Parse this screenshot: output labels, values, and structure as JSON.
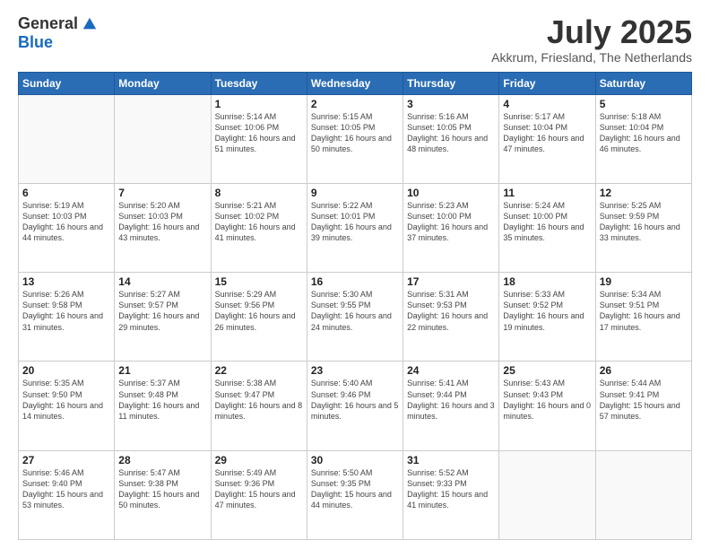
{
  "logo": {
    "general": "General",
    "blue": "Blue"
  },
  "title": "July 2025",
  "location": "Akkrum, Friesland, The Netherlands",
  "headers": [
    "Sunday",
    "Monday",
    "Tuesday",
    "Wednesday",
    "Thursday",
    "Friday",
    "Saturday"
  ],
  "weeks": [
    [
      {
        "day": "",
        "text": ""
      },
      {
        "day": "",
        "text": ""
      },
      {
        "day": "1",
        "text": "Sunrise: 5:14 AM\nSunset: 10:06 PM\nDaylight: 16 hours\nand 51 minutes."
      },
      {
        "day": "2",
        "text": "Sunrise: 5:15 AM\nSunset: 10:05 PM\nDaylight: 16 hours\nand 50 minutes."
      },
      {
        "day": "3",
        "text": "Sunrise: 5:16 AM\nSunset: 10:05 PM\nDaylight: 16 hours\nand 48 minutes."
      },
      {
        "day": "4",
        "text": "Sunrise: 5:17 AM\nSunset: 10:04 PM\nDaylight: 16 hours\nand 47 minutes."
      },
      {
        "day": "5",
        "text": "Sunrise: 5:18 AM\nSunset: 10:04 PM\nDaylight: 16 hours\nand 46 minutes."
      }
    ],
    [
      {
        "day": "6",
        "text": "Sunrise: 5:19 AM\nSunset: 10:03 PM\nDaylight: 16 hours\nand 44 minutes."
      },
      {
        "day": "7",
        "text": "Sunrise: 5:20 AM\nSunset: 10:03 PM\nDaylight: 16 hours\nand 43 minutes."
      },
      {
        "day": "8",
        "text": "Sunrise: 5:21 AM\nSunset: 10:02 PM\nDaylight: 16 hours\nand 41 minutes."
      },
      {
        "day": "9",
        "text": "Sunrise: 5:22 AM\nSunset: 10:01 PM\nDaylight: 16 hours\nand 39 minutes."
      },
      {
        "day": "10",
        "text": "Sunrise: 5:23 AM\nSunset: 10:00 PM\nDaylight: 16 hours\nand 37 minutes."
      },
      {
        "day": "11",
        "text": "Sunrise: 5:24 AM\nSunset: 10:00 PM\nDaylight: 16 hours\nand 35 minutes."
      },
      {
        "day": "12",
        "text": "Sunrise: 5:25 AM\nSunset: 9:59 PM\nDaylight: 16 hours\nand 33 minutes."
      }
    ],
    [
      {
        "day": "13",
        "text": "Sunrise: 5:26 AM\nSunset: 9:58 PM\nDaylight: 16 hours\nand 31 minutes."
      },
      {
        "day": "14",
        "text": "Sunrise: 5:27 AM\nSunset: 9:57 PM\nDaylight: 16 hours\nand 29 minutes."
      },
      {
        "day": "15",
        "text": "Sunrise: 5:29 AM\nSunset: 9:56 PM\nDaylight: 16 hours\nand 26 minutes."
      },
      {
        "day": "16",
        "text": "Sunrise: 5:30 AM\nSunset: 9:55 PM\nDaylight: 16 hours\nand 24 minutes."
      },
      {
        "day": "17",
        "text": "Sunrise: 5:31 AM\nSunset: 9:53 PM\nDaylight: 16 hours\nand 22 minutes."
      },
      {
        "day": "18",
        "text": "Sunrise: 5:33 AM\nSunset: 9:52 PM\nDaylight: 16 hours\nand 19 minutes."
      },
      {
        "day": "19",
        "text": "Sunrise: 5:34 AM\nSunset: 9:51 PM\nDaylight: 16 hours\nand 17 minutes."
      }
    ],
    [
      {
        "day": "20",
        "text": "Sunrise: 5:35 AM\nSunset: 9:50 PM\nDaylight: 16 hours\nand 14 minutes."
      },
      {
        "day": "21",
        "text": "Sunrise: 5:37 AM\nSunset: 9:48 PM\nDaylight: 16 hours\nand 11 minutes."
      },
      {
        "day": "22",
        "text": "Sunrise: 5:38 AM\nSunset: 9:47 PM\nDaylight: 16 hours\nand 8 minutes."
      },
      {
        "day": "23",
        "text": "Sunrise: 5:40 AM\nSunset: 9:46 PM\nDaylight: 16 hours\nand 5 minutes."
      },
      {
        "day": "24",
        "text": "Sunrise: 5:41 AM\nSunset: 9:44 PM\nDaylight: 16 hours\nand 3 minutes."
      },
      {
        "day": "25",
        "text": "Sunrise: 5:43 AM\nSunset: 9:43 PM\nDaylight: 16 hours\nand 0 minutes."
      },
      {
        "day": "26",
        "text": "Sunrise: 5:44 AM\nSunset: 9:41 PM\nDaylight: 15 hours\nand 57 minutes."
      }
    ],
    [
      {
        "day": "27",
        "text": "Sunrise: 5:46 AM\nSunset: 9:40 PM\nDaylight: 15 hours\nand 53 minutes."
      },
      {
        "day": "28",
        "text": "Sunrise: 5:47 AM\nSunset: 9:38 PM\nDaylight: 15 hours\nand 50 minutes."
      },
      {
        "day": "29",
        "text": "Sunrise: 5:49 AM\nSunset: 9:36 PM\nDaylight: 15 hours\nand 47 minutes."
      },
      {
        "day": "30",
        "text": "Sunrise: 5:50 AM\nSunset: 9:35 PM\nDaylight: 15 hours\nand 44 minutes."
      },
      {
        "day": "31",
        "text": "Sunrise: 5:52 AM\nSunset: 9:33 PM\nDaylight: 15 hours\nand 41 minutes."
      },
      {
        "day": "",
        "text": ""
      },
      {
        "day": "",
        "text": ""
      }
    ]
  ]
}
